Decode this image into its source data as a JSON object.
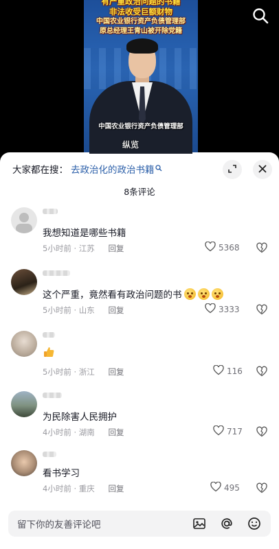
{
  "video": {
    "headline": [
      "有严重政治问题的书籍",
      "非法收受巨额财物",
      "中国农业银行资产负债管理部",
      "原总经理王青山被开除党籍"
    ],
    "anchor_caption": "中国农业银行资产负债管理部",
    "watermark": "纵览"
  },
  "sheet": {
    "search_prefix": "大家都在搜：",
    "search_query": "去政治化的政治书籍",
    "comment_count": "8条评论",
    "reply_label": "回复",
    "input_placeholder": "留下你的友善评论吧"
  },
  "comments": [
    {
      "text": "我想知道是哪些书籍",
      "time": "5小时前",
      "location": "江苏",
      "likes": "5368"
    },
    {
      "text": "这个严重，竟然看有政治问题的书",
      "time": "5小时前",
      "location": "山东",
      "likes": "3333"
    },
    {
      "text": "",
      "time": "5小时前",
      "location": "浙江",
      "likes": "116"
    },
    {
      "text": "为民除害人民拥护",
      "time": "4小时前",
      "location": "湖南",
      "likes": "717"
    },
    {
      "text": "看书学习",
      "time": "4小时前",
      "location": "重庆",
      "likes": "495"
    }
  ],
  "icons": {
    "search": "search-icon",
    "expand": "expand-icon",
    "close": "close-icon",
    "like": "heart-outline-icon",
    "dislike": "broken-heart-icon",
    "image": "image-icon",
    "mention": "at-icon",
    "emoji": "emoji-icon"
  },
  "colors": {
    "link": "#2a5ea8",
    "meta": "#9a9aa0",
    "headline": "#ffe23d"
  }
}
